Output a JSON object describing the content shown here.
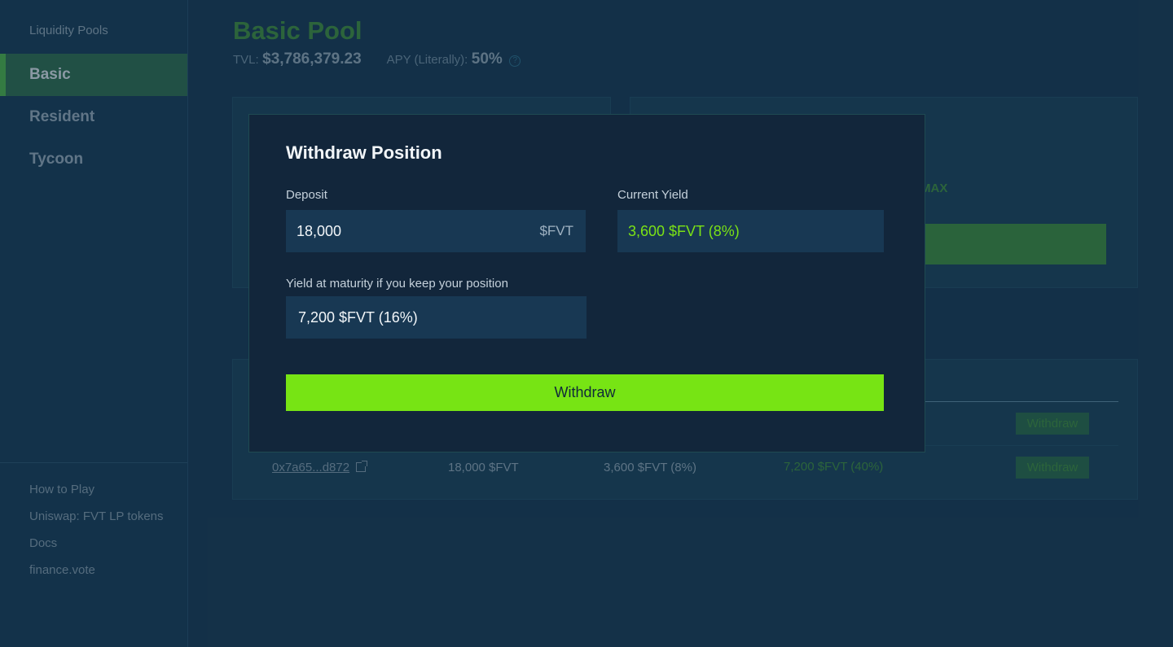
{
  "sidebar": {
    "heading": "Liquidity Pools",
    "nav": [
      {
        "label": "Basic",
        "active": true
      },
      {
        "label": "Resident",
        "active": false
      },
      {
        "label": "Tycoon",
        "active": false
      }
    ],
    "footer_links": [
      {
        "label": "How to Play"
      },
      {
        "label": "Uniswap: FVT LP tokens"
      },
      {
        "label": "Docs"
      },
      {
        "label": "finance.vote"
      }
    ]
  },
  "main": {
    "title": "Basic Pool",
    "tvl_label": "TVL:",
    "tvl_value": "$3,786,379.23",
    "apy_label": "APY (Literally):",
    "apy_value": "50%",
    "help_icon": "question-circle-icon",
    "max_label": "MAX",
    "positions": [
      {
        "id": "row1",
        "withdraw_label": "Withdraw"
      },
      {
        "id": "row2",
        "address": "0x7a65...d872",
        "deposit": "18,000 $FVT",
        "current_yield": "3,600 $FVT (8%)",
        "maturity_yield": "7,200 $FVT (40%)",
        "withdraw_label": "Withdraw"
      }
    ]
  },
  "modal": {
    "title": "Withdraw Position",
    "deposit_label": "Deposit",
    "deposit_value": "18,000",
    "deposit_suffix": "$FVT",
    "current_yield_label": "Current Yield",
    "current_yield_value": "3,600 $FVT (8%)",
    "maturity_label": "Yield at maturity if you keep your position",
    "maturity_value": "7,200 $FVT (16%)",
    "withdraw_button": "Withdraw"
  },
  "colors": {
    "accent": "#77e414",
    "brand_green": "#3f8d45",
    "background": "#1a3d59",
    "modal_bg": "#12263b"
  }
}
